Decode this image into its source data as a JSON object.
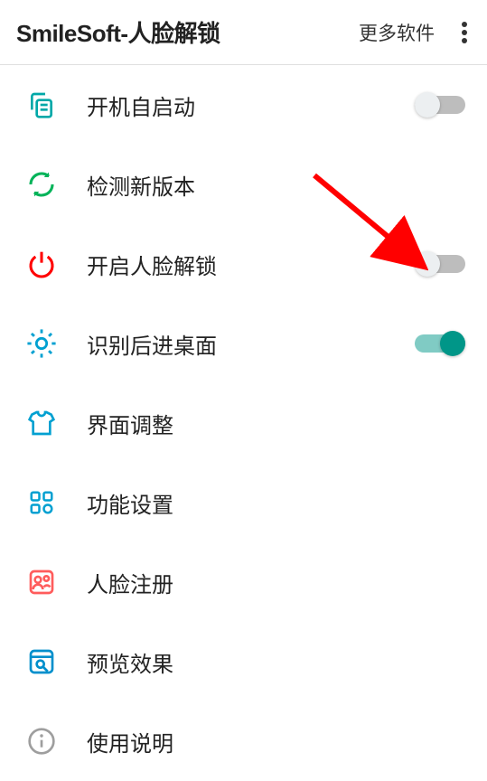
{
  "header": {
    "title": "SmileSoft-人脸解锁",
    "more_software": "更多软件"
  },
  "rows": [
    {
      "id": "autostart",
      "icon": "copy-icon",
      "icon_color": "#00a8a8",
      "label": "开机自启动",
      "toggle": "off"
    },
    {
      "id": "check-update",
      "icon": "refresh-icon",
      "icon_color": "#00b359",
      "label": "检测新版本"
    },
    {
      "id": "enable-face",
      "icon": "power-icon",
      "icon_color": "#ff0000",
      "label": "开启人脸解锁",
      "toggle": "off"
    },
    {
      "id": "go-desktop",
      "icon": "brightness-icon",
      "icon_color": "#00a0d1",
      "label": "识别后进桌面",
      "toggle": "on"
    },
    {
      "id": "ui-adjust",
      "icon": "shirt-icon",
      "icon_color": "#00a0d1",
      "label": "界面调整"
    },
    {
      "id": "features",
      "icon": "grid-icon",
      "icon_color": "#00a0d1",
      "label": "功能设置"
    },
    {
      "id": "face-reg",
      "icon": "users-icon",
      "icon_color": "#ff5c5c",
      "label": "人脸注册"
    },
    {
      "id": "preview",
      "icon": "preview-icon",
      "icon_color": "#008fcc",
      "label": "预览效果"
    },
    {
      "id": "instructions",
      "icon": "info-icon",
      "icon_color": "#9e9e9e",
      "label": "使用说明"
    }
  ]
}
